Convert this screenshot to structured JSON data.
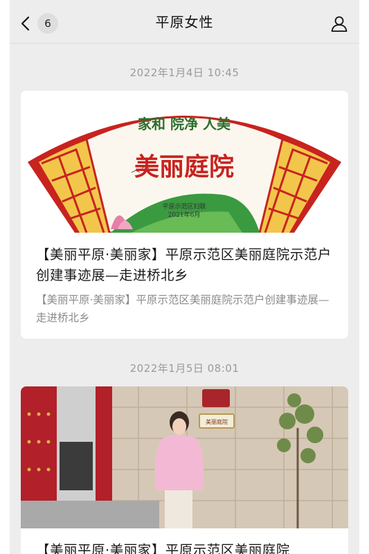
{
  "header": {
    "title": "平原女性",
    "back_badge": "6"
  },
  "articles": [
    {
      "timestamp": "2022年1月4日 10:45",
      "cover": {
        "slogan": "家和 院净 人美",
        "banner_text": "美丽庭院",
        "seal_line1": "平原示范区妇联",
        "seal_line2": "2021年6月"
      },
      "title": "【美丽平原·美丽家】平原示范区美丽庭院示范户创建事迹展—走进桥北乡",
      "digest": "【美丽平原·美丽家】平原示范区美丽庭院示范户创建事迹展—走进桥北乡"
    },
    {
      "timestamp": "2022年1月5日 08:01",
      "cover": {
        "plaque_text": "美丽庭院"
      },
      "title": "【美丽平原·美丽家】平原示范区美丽庭院"
    }
  ],
  "colors": {
    "background": "#ededed",
    "card": "#ffffff",
    "timestamp": "#9a9a9a",
    "door_red": "#b2202a"
  }
}
